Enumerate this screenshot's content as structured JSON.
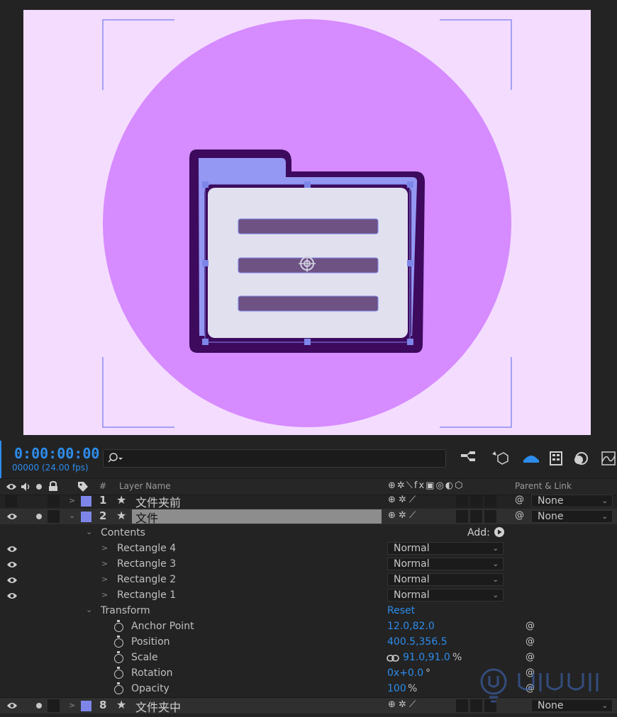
{
  "colors": {
    "viewer_bg": "#f4dcff",
    "circle": "#d68bff",
    "folder_outline": "#3d0a5e",
    "folder_tab": "#9498f3",
    "folder_front": "#e0e0ee",
    "lines": "#6e5284",
    "accent_blue": "#2d8ceb",
    "layer_label": "#7d86e8"
  },
  "timeline": {
    "timecode": "0:00:00:00",
    "frames": "00000 (24.00 fps)",
    "search_icon": "search-icon",
    "columns": {
      "hash": "#",
      "layer_name": "Layer Name",
      "parent_link": "Parent & Link"
    },
    "layers": [
      {
        "num": "1",
        "name": "文件夹前",
        "parent": "None"
      },
      {
        "num": "2",
        "name": "文件",
        "parent": "None"
      },
      {
        "num": "8",
        "name": "文件夹中",
        "parent": "None"
      }
    ],
    "contents": {
      "label": "Contents",
      "add_label": "Add:",
      "items": [
        {
          "name": "Rectangle 4",
          "mode": "Normal"
        },
        {
          "name": "Rectangle 3",
          "mode": "Normal"
        },
        {
          "name": "Rectangle 2",
          "mode": "Normal"
        },
        {
          "name": "Rectangle 1",
          "mode": "Normal"
        }
      ]
    },
    "transform": {
      "label": "Transform",
      "reset": "Reset",
      "anchor_label": "Anchor Point",
      "anchor_value": "12.0,82.0",
      "position_label": "Position",
      "position_value": "400.5,356.5",
      "scale_label": "Scale",
      "scale_value": "91.0,91.0",
      "scale_unit": "%",
      "rotation_label": "Rotation",
      "rotation_value": "0x+0.0",
      "rotation_unit": "°",
      "opacity_label": "Opacity",
      "opacity_value": "100",
      "opacity_unit": "%"
    }
  }
}
